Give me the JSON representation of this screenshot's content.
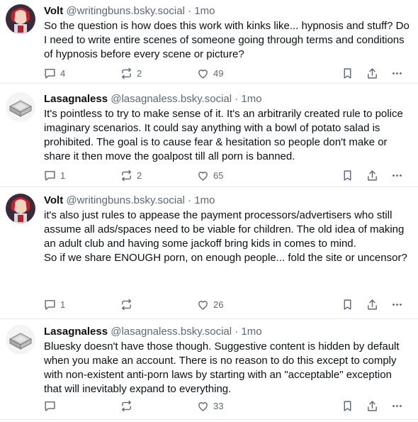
{
  "posts": [
    {
      "author": "Volt",
      "handle": "@writingbuns.bsky.social",
      "time": "· 1mo",
      "text": "So the question is how does this work with kinks like... hypnosis and stuff? Do I need to write entire scenes of someone going through terms and conditions of hypnosis before every scene or picture?",
      "replies": "4",
      "reposts": "2",
      "likes": "49"
    },
    {
      "author": "Lasagnaless",
      "handle": "@lasagnaless.bsky.social",
      "time": "· 1mo",
      "text": "It's pointless to try to make sense of it. It's an arbitrarily created rule to police imaginary scenarios. It could say anything with a bowl of potato salad is prohibited. The goal is to cause fear & hesitation so people don't make or share it then move the goalpost till all porn is banned.",
      "replies": "1",
      "reposts": "2",
      "likes": "65"
    },
    {
      "author": "Volt",
      "handle": "@writingbuns.bsky.social",
      "time": "· 1mo",
      "text": "it's also just rules to appease the payment processors/advertisers who still assume all ads/spaces need to be viable for children. The old idea of making an adult club and having some jackoff bring kids in comes to mind.\nSo if we share ENOUGH porn, on enough people... fold the site or uncensor?",
      "replies": "1",
      "reposts": "",
      "likes": "26"
    },
    {
      "author": "Lasagnaless",
      "handle": "@lasagnaless.bsky.social",
      "time": "· 1mo",
      "text": "Bluesky doesn't have those though. Suggestive content is hidden by default when you make an account. There is no reason to do this except to comply with non-existent anti-porn laws by starting with an \"acceptable\" exception that will inevitably expand to everything.",
      "replies": "",
      "reposts": "",
      "likes": "33"
    }
  ],
  "icons": {
    "reply": "reply-icon",
    "repost": "repost-icon",
    "like": "heart-icon",
    "bookmark": "bookmark-icon",
    "share": "share-icon",
    "more": "more-icon"
  },
  "colors": {
    "text": "#0b0f14",
    "muted": "#5b6878",
    "divider": "#e6e9ee"
  }
}
